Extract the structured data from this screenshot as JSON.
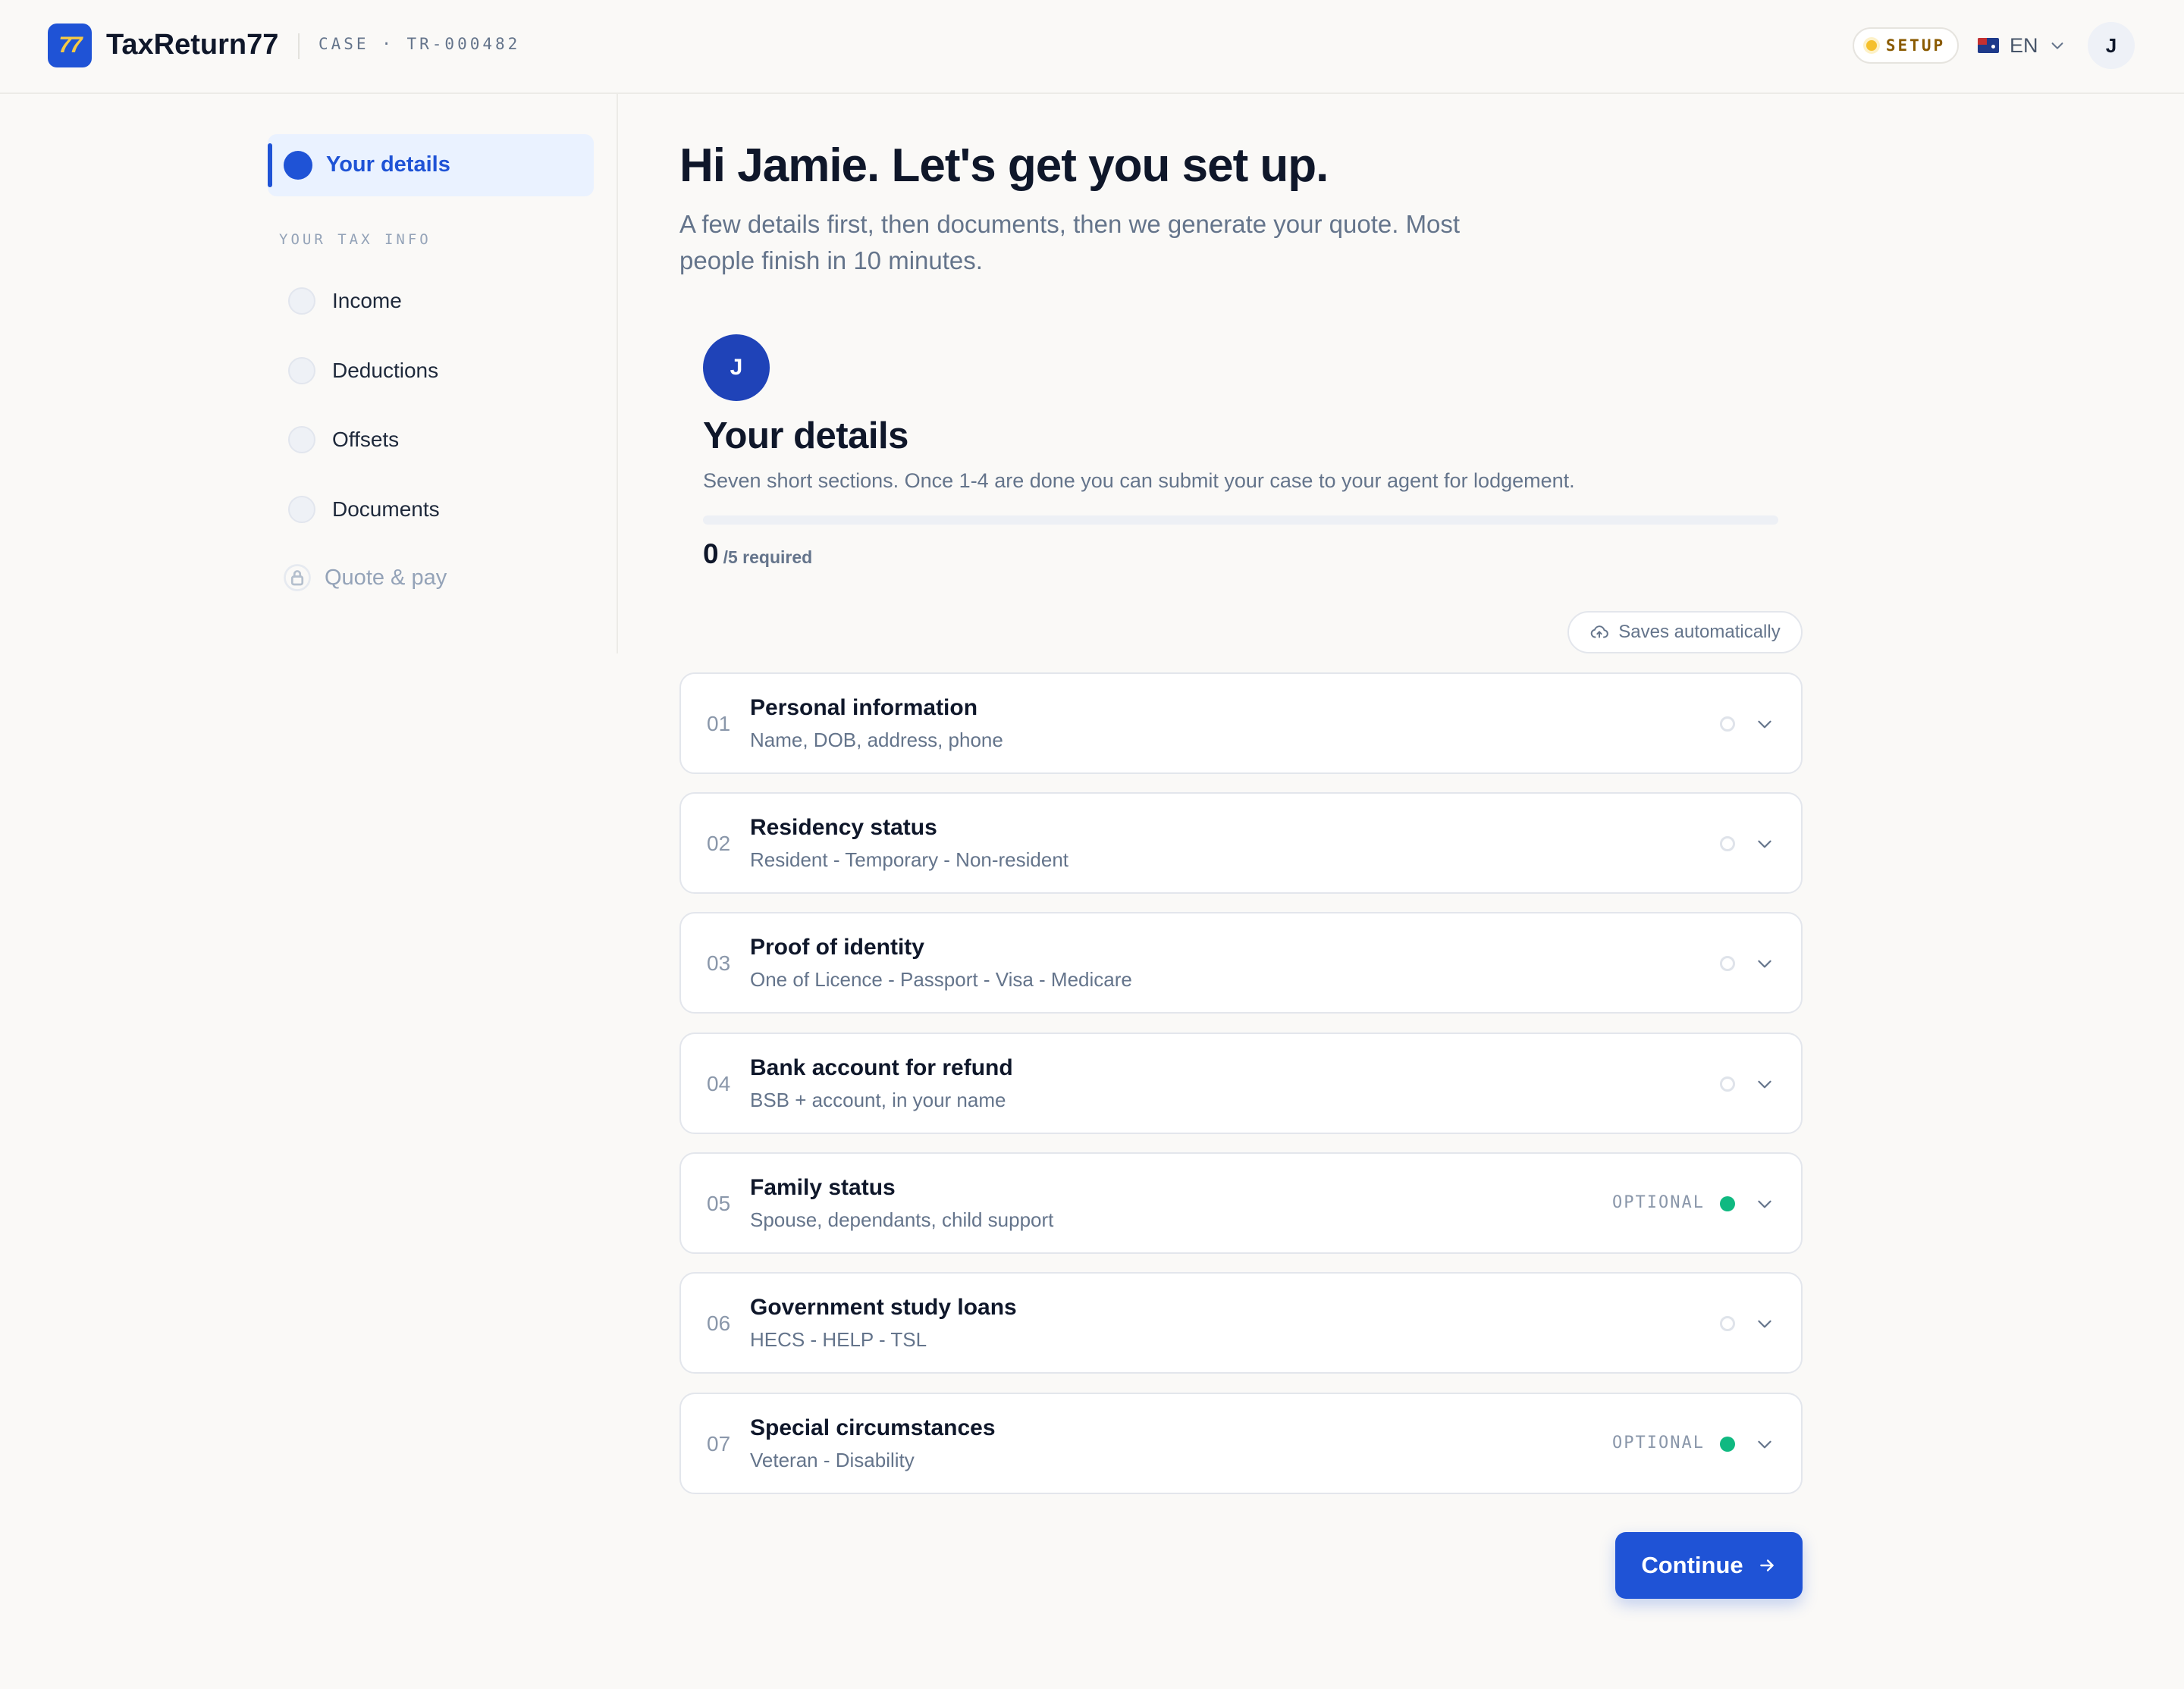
{
  "header": {
    "logo_text": "77",
    "brand": "TaxReturn77",
    "case_label": "CASE · TR-000482",
    "status_badge": "SETUP",
    "language": "EN",
    "user_initial": "J",
    "accent": "#1f53d6"
  },
  "sidebar": {
    "active_item": "Your details",
    "section_label": "YOUR TAX INFO",
    "items": [
      {
        "label": "Income"
      },
      {
        "label": "Deductions"
      },
      {
        "label": "Offsets"
      },
      {
        "label": "Documents"
      }
    ],
    "locked_item": "Quote & pay",
    "locked_icon": "lock-icon"
  },
  "main": {
    "greeting": "Hi Jamie. Let's get you set up.",
    "intro": "A few details first, then documents, then we generate your quote. Most people finish in 10 minutes.",
    "card": {
      "avatar_initial": "J",
      "title": "Your details",
      "subtitle": "Seven short sections. Once 1-4 are done you can submit your case to your agent for lodgement.",
      "progress_done": "0",
      "progress_required": "/5 required",
      "progress_fraction": 0
    },
    "autosave": "Saves automatically",
    "sections": [
      {
        "num": "01",
        "title": "Personal information",
        "desc": "Name, DOB, address, phone",
        "optional": "",
        "status": "empty"
      },
      {
        "num": "02",
        "title": "Residency status",
        "desc": "Resident - Temporary - Non-resident",
        "optional": "",
        "status": "empty"
      },
      {
        "num": "03",
        "title": "Proof of identity",
        "desc": "One of Licence - Passport - Visa - Medicare",
        "optional": "",
        "status": "empty"
      },
      {
        "num": "04",
        "title": "Bank account for refund",
        "desc": "BSB + account, in your name",
        "optional": "",
        "status": "empty"
      },
      {
        "num": "05",
        "title": "Family status",
        "desc": "Spouse, dependants, child support",
        "optional": "OPTIONAL",
        "status": "done"
      },
      {
        "num": "06",
        "title": "Government study loans",
        "desc": "HECS - HELP - TSL",
        "optional": "",
        "status": "empty"
      },
      {
        "num": "07",
        "title": "Special circumstances",
        "desc": "Veteran - Disability",
        "optional": "OPTIONAL",
        "status": "done"
      }
    ],
    "continue_label": "Continue"
  }
}
